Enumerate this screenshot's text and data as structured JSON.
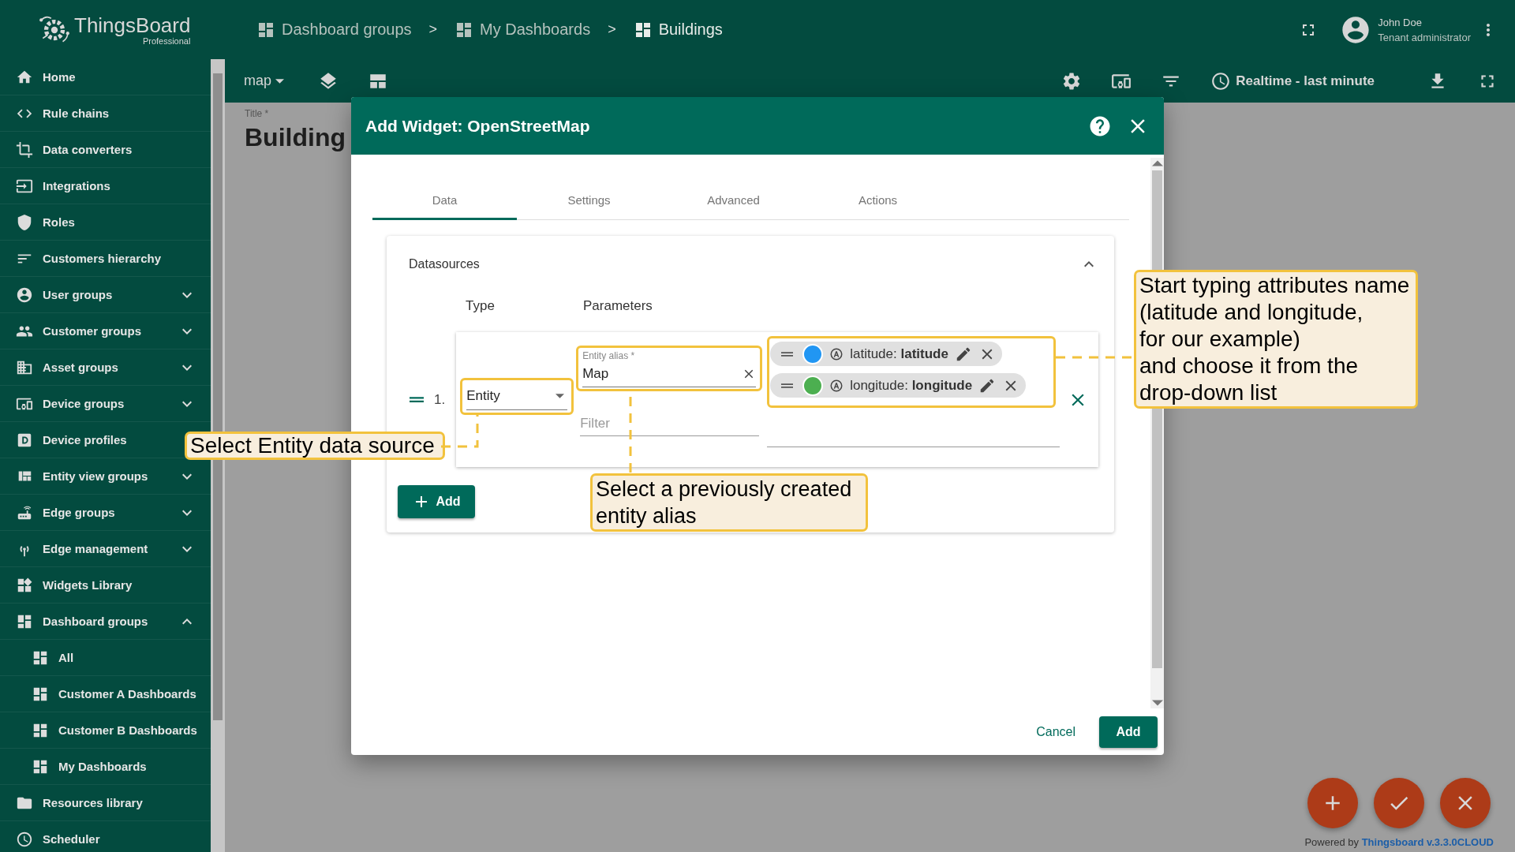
{
  "app": {
    "logo": "ThingsBoard",
    "edition": "Professional"
  },
  "sidebar": {
    "items": [
      {
        "label": "Home",
        "kind": "link"
      },
      {
        "label": "Rule chains",
        "kind": "link"
      },
      {
        "label": "Data converters",
        "kind": "link"
      },
      {
        "label": "Integrations",
        "kind": "link"
      },
      {
        "label": "Roles",
        "kind": "link"
      },
      {
        "label": "Customers hierarchy",
        "kind": "link"
      },
      {
        "label": "User groups",
        "kind": "group",
        "expanded": false
      },
      {
        "label": "Customer groups",
        "kind": "group",
        "expanded": false
      },
      {
        "label": "Asset groups",
        "kind": "group",
        "expanded": false
      },
      {
        "label": "Device groups",
        "kind": "group",
        "expanded": false
      },
      {
        "label": "Device profiles",
        "kind": "link"
      },
      {
        "label": "Entity view groups",
        "kind": "group",
        "expanded": false
      },
      {
        "label": "Edge groups",
        "kind": "group",
        "expanded": false
      },
      {
        "label": "Edge management",
        "kind": "group",
        "expanded": false
      },
      {
        "label": "Widgets Library",
        "kind": "link"
      },
      {
        "label": "Dashboard groups",
        "kind": "group",
        "expanded": true,
        "children": [
          {
            "label": "All"
          },
          {
            "label": "Customer A Dashboards"
          },
          {
            "label": "Customer B Dashboards"
          },
          {
            "label": "My Dashboards"
          }
        ]
      },
      {
        "label": "Resources library",
        "kind": "link"
      },
      {
        "label": "Scheduler",
        "kind": "link"
      }
    ]
  },
  "breadcrumbs": [
    {
      "kind": "crumb",
      "label": "Dashboard groups"
    },
    {
      "kind": "separator",
      "label": ">"
    },
    {
      "kind": "crumb",
      "label": "My Dashboards"
    },
    {
      "kind": "separator",
      "label": ">"
    },
    {
      "kind": "crumb",
      "label": "Buildings"
    }
  ],
  "user": {
    "name": "John Doe",
    "role": "Tenant administrator"
  },
  "toolbar": {
    "state": "map",
    "timewindow": "Realtime - last minute"
  },
  "dashboard": {
    "title_label": "Title *",
    "title": "Building"
  },
  "dialog": {
    "title": "Add Widget: OpenStreetMap",
    "tabs": [
      {
        "label": "Data",
        "selected": true
      },
      {
        "label": "Settings",
        "selected": false
      },
      {
        "label": "Advanced",
        "selected": false
      },
      {
        "label": "Actions",
        "selected": false
      }
    ],
    "datasources": {
      "title": "Datasources",
      "columns": [
        "Type",
        "Parameters"
      ],
      "rows": [
        {
          "index": "1.",
          "type": "Entity",
          "alias_label": "Entity alias *",
          "alias": "Map",
          "filter_placeholder": "Filter",
          "keys": [
            {
              "text": "latitude: **latitude**",
              "color": "#2196f3"
            },
            {
              "text": "longitude: **longitude**",
              "color": "#4caf50"
            }
          ]
        }
      ],
      "add_button": "Add"
    },
    "cancel": "Cancel",
    "confirm": "Add"
  },
  "annotations": [
    {
      "text": "Select Entity data source"
    },
    {
      "text": "Select a previously created\nentity alias"
    },
    {
      "text": "Start typing attributes name\n(latitude and longitude,\nfor our example)\nand choose it from the\ndrop-down list"
    }
  ],
  "footer": {
    "prefix": "Powered by",
    "link": "Thingsboard v.3.3.0CLOUD"
  }
}
